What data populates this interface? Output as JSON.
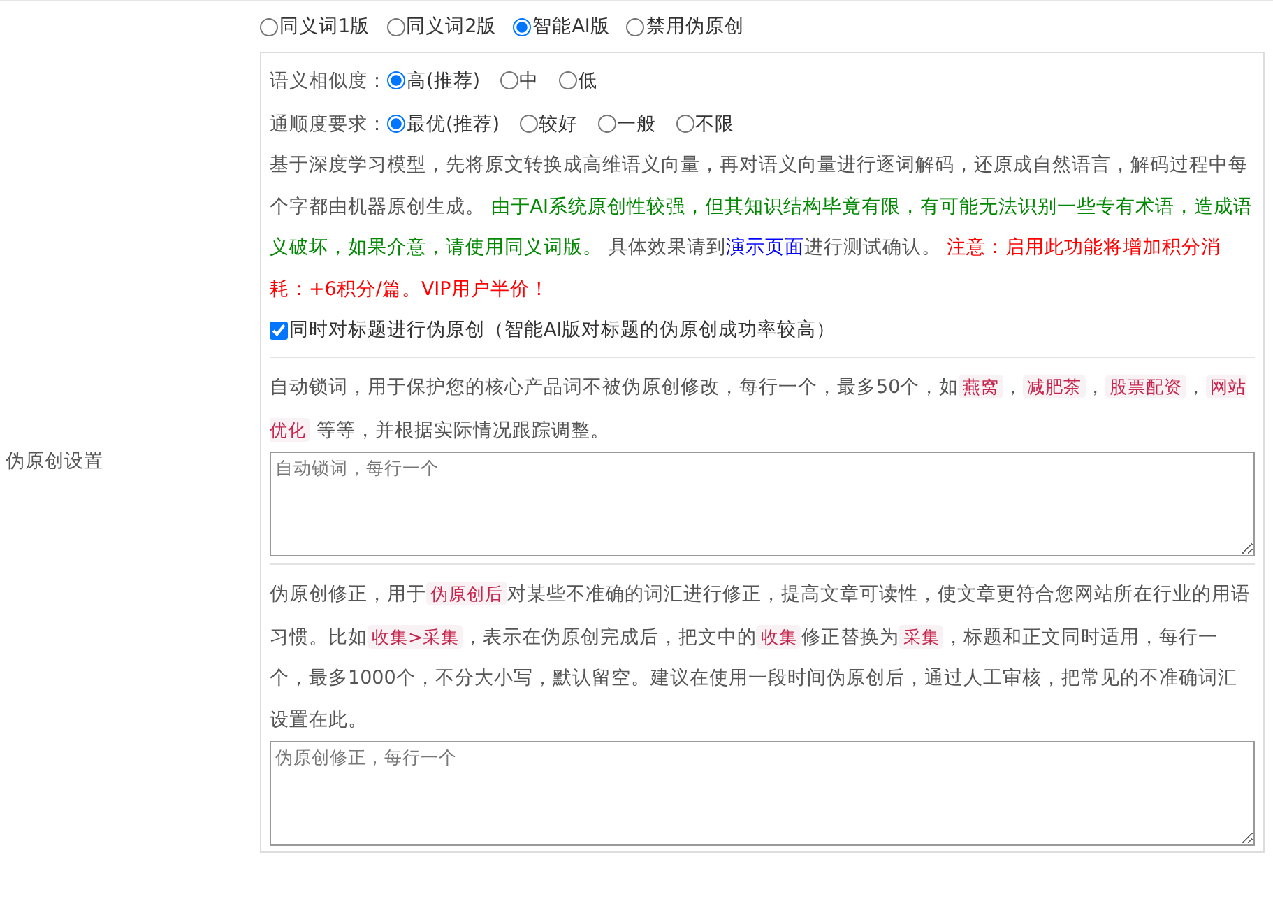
{
  "section_label": "伪原创设置",
  "modes": [
    {
      "label": "同义词1版",
      "selected": false
    },
    {
      "label": "同义词2版",
      "selected": false
    },
    {
      "label": "智能AI版",
      "selected": true
    },
    {
      "label": "禁用伪原创",
      "selected": false
    }
  ],
  "ai_options": [
    {
      "label": "语义相似度：",
      "options": [
        {
          "label": "高(推荐)",
          "selected": true
        },
        {
          "label": "中",
          "selected": false
        },
        {
          "label": "低",
          "selected": false
        }
      ]
    },
    {
      "label": "通顺度要求：",
      "options": [
        {
          "label": "最优(推荐)",
          "selected": true
        },
        {
          "label": "较好",
          "selected": false
        },
        {
          "label": "一般",
          "selected": false
        },
        {
          "label": "不限",
          "selected": false
        }
      ]
    }
  ],
  "description": [
    {
      "kind": "plain",
      "text": "基于深度学习模型，先将原文转换成高维语义向量，再对语义向量进行逐词解码，还原成自然语言，解码过程中每个字都由机器原创生成。 "
    },
    {
      "kind": "green",
      "text": "由于AI系统原创性较强，但其知识结构毕竟有限，有可能无法识别一些专有术语，造成语义破坏，如果介意，请使用同义词版。"
    },
    {
      "kind": "plain",
      "text": " 具体效果请到"
    },
    {
      "kind": "link",
      "text": "演示页面"
    },
    {
      "kind": "plain",
      "text": "进行测试确认。 "
    },
    {
      "kind": "red",
      "text": "注意：启用此功能将增加积分消耗：+6积分/篇。VIP用户半价！"
    }
  ],
  "title_option": {
    "label": "同时对标题进行伪原创（智能AI版对标题的伪原创成功率较高）",
    "checked": true
  },
  "lock_words": {
    "description": [
      {
        "kind": "plain",
        "text": "自动锁词，用于保护您的核心产品词不被伪原创修改，每行一个，最多50个，如"
      },
      {
        "kind": "tag",
        "text": "燕窝"
      },
      {
        "kind": "plain",
        "text": "，"
      },
      {
        "kind": "tag",
        "text": "减肥茶"
      },
      {
        "kind": "plain",
        "text": "，"
      },
      {
        "kind": "tag",
        "text": "股票配资"
      },
      {
        "kind": "plain",
        "text": "，"
      },
      {
        "kind": "tag",
        "text": "网站优化"
      },
      {
        "kind": "plain",
        "text": " 等等，并根据实际情况跟踪调整。"
      }
    ],
    "placeholder": "自动锁词，每行一个"
  },
  "corrections": {
    "description": [
      {
        "kind": "plain",
        "text": "伪原创修正，用于"
      },
      {
        "kind": "tag",
        "text": "伪原创后"
      },
      {
        "kind": "plain",
        "text": "对某些不准确的词汇进行修正，提高文章可读性，使文章更符合您网站所在行业的用语习惯。比如"
      },
      {
        "kind": "tag",
        "text": "收集>采集"
      },
      {
        "kind": "plain",
        "text": "，表示在伪原创完成后，把文中的"
      },
      {
        "kind": "tag",
        "text": "收集"
      },
      {
        "kind": "plain",
        "text": "修正替换为"
      },
      {
        "kind": "tag",
        "text": "采集"
      },
      {
        "kind": "plain",
        "text": "，标题和正文同时适用，每行一个，最多1000个，不分大小写，默认留空。建议在使用一段时间伪原创后，通过人工审核，把常见的不准确词汇设置在此。"
      }
    ],
    "placeholder": "伪原创修正，每行一个"
  }
}
